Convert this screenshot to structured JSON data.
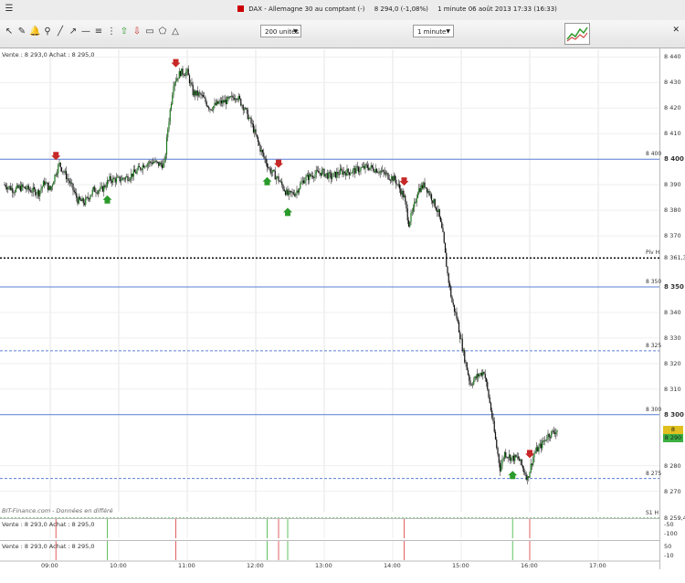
{
  "window": {
    "title": "DAX - Allemagne 30 au comptant (-)",
    "price_info": "8 294,0 (-1,08%)",
    "period_info": "1 minute  06 août 2013 17:33 (16:33)"
  },
  "toolbar": {
    "units_select": "200 unités",
    "timeframe_select": "1 minute",
    "tool_icons": [
      "cursor-icon",
      "pencil-icon",
      "bell-icon",
      "search-icon",
      "line-icon",
      "ray-icon",
      "horizontal-line-icon",
      "fibonacci-icon",
      "arrow-up-icon",
      "arrow-down-icon",
      "rectangle-icon",
      "polygon-icon",
      "triangle-icon"
    ]
  },
  "main_panel": {
    "info": "Vente : 8 293,0 Achat : 8 295,0",
    "watermark": "BIT-Finance.com - Données en différé"
  },
  "sub_panels": [
    {
      "info": "Vente : 8 293,0 Achat : 8 295,0",
      "scale": [
        "-50",
        "-100"
      ]
    },
    {
      "info": "Vente : 8 293,0 Achat : 8 295,0",
      "scale": [
        "50",
        "-10"
      ]
    }
  ],
  "price_axis": [
    {
      "label": "8 440",
      "price": 8440,
      "bold": false
    },
    {
      "label": "8 430",
      "price": 8430,
      "bold": false
    },
    {
      "label": "8 420",
      "price": 8420,
      "bold": false
    },
    {
      "label": "8 410",
      "price": 8410,
      "bold": false
    },
    {
      "label": "8 400",
      "price": 8400,
      "bold": true
    },
    {
      "label": "8 390",
      "price": 8390,
      "bold": false
    },
    {
      "label": "8 380",
      "price": 8380,
      "bold": false
    },
    {
      "label": "8 370",
      "price": 8370,
      "bold": false
    },
    {
      "label": "8 350",
      "price": 8350,
      "bold": true
    },
    {
      "label": "8 340",
      "price": 8340,
      "bold": false
    },
    {
      "label": "8 330",
      "price": 8330,
      "bold": false
    },
    {
      "label": "8 320",
      "price": 8320,
      "bold": false
    },
    {
      "label": "8 310",
      "price": 8310,
      "bold": false
    },
    {
      "label": "8 300",
      "price": 8300,
      "bold": true
    },
    {
      "label": "8 280",
      "price": 8280,
      "bold": false
    },
    {
      "label": "8 270",
      "price": 8270,
      "bold": false
    }
  ],
  "levels": [
    {
      "label": "8 400",
      "price": 8400,
      "style": "solid",
      "color": "#5b7fd6"
    },
    {
      "label": "Piv H",
      "price": 8361.3,
      "style": "dotted-black",
      "color": "#000000",
      "badge": "8 361,3"
    },
    {
      "label": "8 350",
      "price": 8350,
      "style": "solid",
      "color": "#5b7fd6"
    },
    {
      "label": "8 325",
      "price": 8325,
      "style": "dashed",
      "color": "#5b7fd6"
    },
    {
      "label": "8 300",
      "price": 8300,
      "style": "solid",
      "color": "#5b7fd6"
    },
    {
      "label": "8 275",
      "price": 8275,
      "style": "dashed",
      "color": "#5b7fd6"
    },
    {
      "label": "S1 H",
      "price": 8259.4,
      "style": "dotted-green",
      "color": "#2a9a2a",
      "badge": "8 259,4"
    }
  ],
  "current_price": {
    "label": "8 294,0",
    "value": 8294.0,
    "color": "#e0c020"
  },
  "bid_badge": {
    "label": "8 290",
    "color": "#3cb043"
  },
  "time_axis": [
    "09:00",
    "10:00",
    "11:00",
    "12:00",
    "13:00",
    "14:00",
    "15:00",
    "16:00",
    "17:00"
  ],
  "chart_data": {
    "type": "candlestick",
    "x_unit": "minutes from 09:00",
    "ylim": [
      8262,
      8443
    ],
    "series_points": [
      [
        -40,
        8390
      ],
      [
        -32,
        8388
      ],
      [
        -25,
        8389
      ],
      [
        -18,
        8388
      ],
      [
        -10,
        8387
      ],
      [
        -5,
        8391
      ],
      [
        0,
        8388
      ],
      [
        5,
        8395
      ],
      [
        8,
        8398
      ],
      [
        12,
        8395
      ],
      [
        18,
        8390
      ],
      [
        24,
        8384
      ],
      [
        30,
        8383
      ],
      [
        38,
        8388
      ],
      [
        45,
        8388
      ],
      [
        52,
        8392
      ],
      [
        60,
        8392
      ],
      [
        68,
        8393
      ],
      [
        75,
        8395
      ],
      [
        82,
        8398
      ],
      [
        90,
        8399
      ],
      [
        95,
        8398
      ],
      [
        100,
        8398
      ],
      [
        103,
        8412
      ],
      [
        108,
        8430
      ],
      [
        114,
        8434
      ],
      [
        120,
        8434
      ],
      [
        125,
        8426
      ],
      [
        132,
        8425
      ],
      [
        140,
        8420
      ],
      [
        148,
        8422
      ],
      [
        156,
        8423
      ],
      [
        163,
        8425
      ],
      [
        170,
        8420
      ],
      [
        177,
        8413
      ],
      [
        184,
        8404
      ],
      [
        192,
        8396
      ],
      [
        200,
        8392
      ],
      [
        208,
        8386
      ],
      [
        215,
        8387
      ],
      [
        222,
        8392
      ],
      [
        230,
        8394
      ],
      [
        238,
        8395
      ],
      [
        246,
        8393
      ],
      [
        254,
        8395
      ],
      [
        262,
        8395
      ],
      [
        270,
        8396
      ],
      [
        278,
        8397
      ],
      [
        286,
        8396
      ],
      [
        294,
        8394
      ],
      [
        302,
        8392
      ],
      [
        310,
        8385
      ],
      [
        314,
        8375
      ],
      [
        318,
        8380
      ],
      [
        322,
        8388
      ],
      [
        328,
        8390
      ],
      [
        334,
        8385
      ],
      [
        340,
        8379
      ],
      [
        344,
        8370
      ],
      [
        348,
        8355
      ],
      [
        352,
        8344
      ],
      [
        356,
        8338
      ],
      [
        362,
        8324
      ],
      [
        368,
        8312
      ],
      [
        374,
        8315
      ],
      [
        380,
        8317
      ],
      [
        386,
        8302
      ],
      [
        390,
        8290
      ],
      [
        394,
        8279
      ],
      [
        398,
        8285
      ],
      [
        404,
        8283
      ],
      [
        410,
        8283
      ],
      [
        414,
        8279
      ],
      [
        418,
        8275
      ],
      [
        424,
        8285
      ],
      [
        430,
        8288
      ],
      [
        436,
        8292
      ],
      [
        440,
        8293
      ],
      [
        444,
        8294
      ]
    ],
    "signals": [
      {
        "t": 5,
        "dir": "down"
      },
      {
        "t": 50,
        "dir": "up"
      },
      {
        "t": 110,
        "dir": "down"
      },
      {
        "t": 190,
        "dir": "up"
      },
      {
        "t": 200,
        "dir": "down"
      },
      {
        "t": 208,
        "dir": "up"
      },
      {
        "t": 310,
        "dir": "down"
      },
      {
        "t": 420,
        "dir": "down"
      },
      {
        "t": 405,
        "dir": "up"
      }
    ]
  }
}
